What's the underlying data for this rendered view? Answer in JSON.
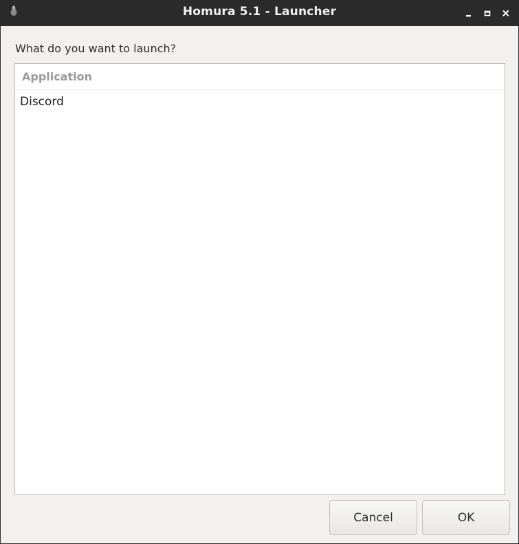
{
  "window": {
    "title": "Homura 5.1 - Launcher",
    "icons": {
      "app": "homura-app-icon",
      "minimize": "minimize-icon",
      "maximize": "maximize-icon",
      "close": "close-icon"
    }
  },
  "dialog": {
    "prompt": "What do you want to launch?",
    "list": {
      "column_header": "Application",
      "items": [
        "Discord"
      ]
    },
    "buttons": {
      "cancel_label": "Cancel",
      "ok_label": "OK"
    }
  },
  "colors": {
    "titlebar": "#2b2b2b",
    "window_bg": "#f2f1f0",
    "list_bg": "#ffffff",
    "header_text": "#9a9a9a"
  }
}
